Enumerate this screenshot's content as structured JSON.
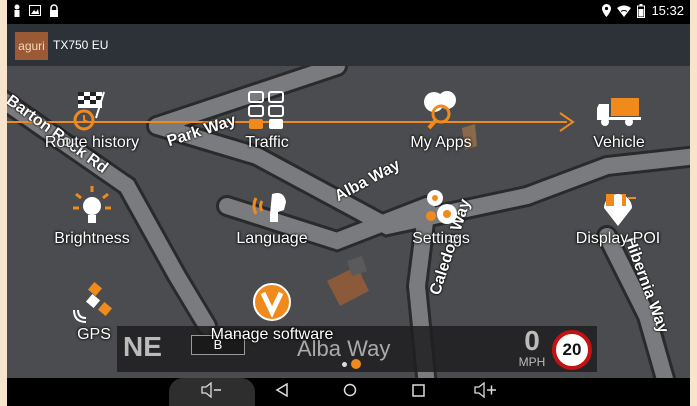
{
  "status_bar": {
    "left_icons": [
      "person-icon",
      "image-icon",
      "lock-icon"
    ],
    "right_icons": [
      "location-icon",
      "wifi-icon",
      "battery-icon"
    ],
    "time": "15:32"
  },
  "app_header": {
    "logo_text": "aguri",
    "device_name": "TX750 EU"
  },
  "menu": {
    "items": [
      {
        "label": "Route history",
        "icon": "route-history-icon"
      },
      {
        "label": "Traffic",
        "icon": "traffic-icon"
      },
      {
        "label": "My Apps",
        "icon": "my-apps-icon"
      },
      {
        "label": "Vehicle",
        "icon": "truck-icon"
      },
      {
        "label": "Brightness",
        "icon": "brightness-icon"
      },
      {
        "label": "Language",
        "icon": "language-icon"
      },
      {
        "label": "Settings",
        "icon": "settings-icon"
      },
      {
        "label": "Display POI",
        "icon": "poi-icon"
      },
      {
        "label": "GPS",
        "icon": "satellite-icon"
      },
      {
        "label": "Manage software",
        "icon": "software-icon"
      }
    ],
    "page_indicator": {
      "pages": 2,
      "current": 2
    }
  },
  "map": {
    "streets": [
      "Barton Rock Rd",
      "Park Way",
      "Alba Way",
      "Caledon Way",
      "Hibernia Way"
    ],
    "heading": "NE",
    "street_box": "B",
    "current_street": "Alba Way",
    "speed": "0",
    "speed_unit": "MPH",
    "speed_limit": "20"
  },
  "nav_bar": {
    "buttons": [
      "volume-down-icon",
      "back-icon",
      "home-icon",
      "recents-icon",
      "volume-up-icon"
    ]
  },
  "colors": {
    "accent": "#f08a1c",
    "limit_ring": "#c31212",
    "page_bg": "#f7e4cc"
  }
}
